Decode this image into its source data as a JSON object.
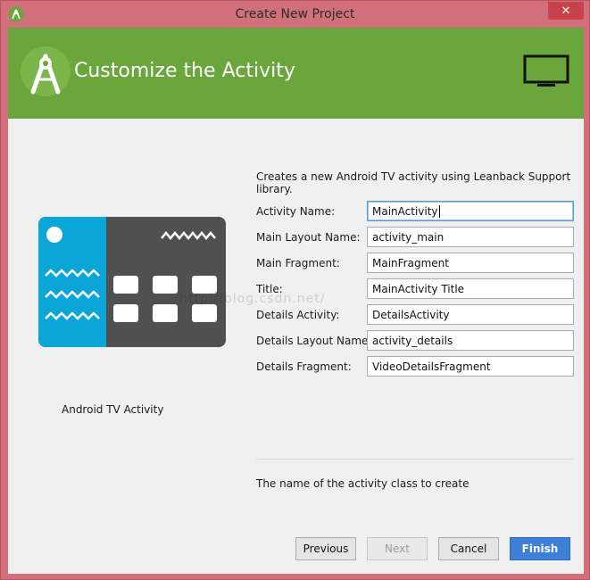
{
  "window": {
    "title": "Create New Project",
    "close_glyph": "✕"
  },
  "header": {
    "title": "Customize the Activity",
    "logo_icon": "android-studio-icon",
    "device_icon": "tv-icon"
  },
  "description": "Creates a new Android TV activity using Leanback Support library.",
  "form": {
    "fields": [
      {
        "label": "Activity Name:",
        "value": "MainActivity"
      },
      {
        "label": "Main Layout Name:",
        "value": "activity_main"
      },
      {
        "label": "Main Fragment:",
        "value": "MainFragment"
      },
      {
        "label": "Title:",
        "value": "MainActivity Title"
      },
      {
        "label": "Details Activity:",
        "value": "DetailsActivity"
      },
      {
        "label": "Details Layout Name:",
        "value": "activity_details"
      },
      {
        "label": "Details Fragment:",
        "value": "VideoDetailsFragment"
      }
    ]
  },
  "preview": {
    "caption": "Android TV Activity"
  },
  "hint": "The name of the activity class to create",
  "buttons": {
    "previous": "Previous",
    "next": "Next",
    "cancel": "Cancel",
    "finish": "Finish"
  },
  "watermark": "http://blog.csdn.net/",
  "colors": {
    "header_green": "#6aa63c",
    "primary_blue": "#3e7fd7",
    "preview_cyan": "#0aa6d8",
    "preview_dark": "#505050"
  }
}
